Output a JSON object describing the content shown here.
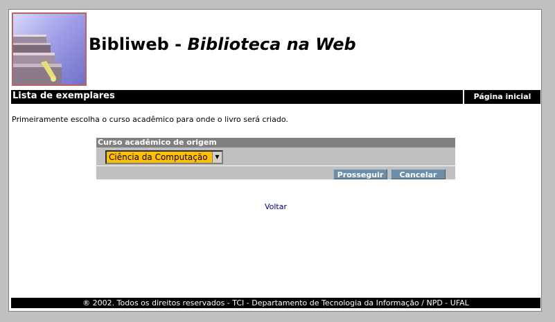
{
  "header": {
    "title_plain": "Bibliweb - ",
    "title_italic": "Biblioteca na Web"
  },
  "topbar": {
    "section": "Lista de exemplares",
    "home_link": "Página inicial"
  },
  "main": {
    "intro": "Primeiramente escolha o curso acadêmico para onde o livro será criado.",
    "form": {
      "header": "Curso acadêmico de origem",
      "course_select": {
        "selected": "Ciência da Computação"
      },
      "proceed_label": "Prosseguir",
      "cancel_label": "Cancelar"
    },
    "back_link": "Voltar"
  },
  "footer": {
    "copyright": "® 2002. Todos os direitos reservados - TCI - Departamento de Tecnologia da Informação / NPD - UFAL"
  },
  "icons": {
    "logo": "books-stack-logo",
    "select_arrow": "dropdown-arrow-icon"
  },
  "colors": {
    "page_bg": "#c0c0c0",
    "bar": "#000000",
    "form_header": "#808080",
    "form_bg": "#c0c0c0",
    "select_bg": "#ffc000",
    "button": "#6e8ea8",
    "link": "#000080"
  }
}
